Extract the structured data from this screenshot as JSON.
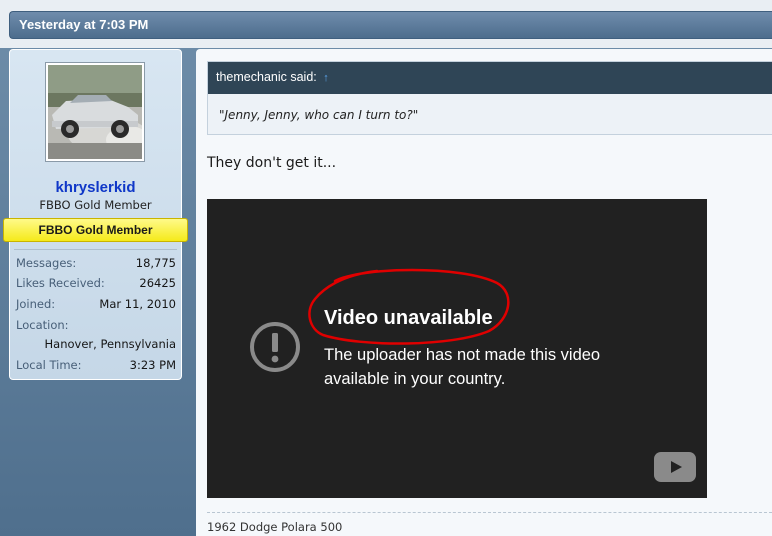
{
  "post": {
    "date": "Yesterday at 7:03 PM"
  },
  "user": {
    "username": "khryslerkid",
    "title": "FBBO Gold Member",
    "banner": "FBBO Gold Member",
    "stats": [
      {
        "label": "Messages:",
        "value": "18,775"
      },
      {
        "label": "Likes Received:",
        "value": "26425"
      },
      {
        "label": "Joined:",
        "value": "Mar 11, 2010"
      },
      {
        "label": "Location:",
        "value": ""
      },
      {
        "label": "",
        "value": "Hanover, Pennsylvania"
      },
      {
        "label": "Local Time:",
        "value": "3:23 PM"
      }
    ]
  },
  "quote": {
    "author": "themechanic said:",
    "arrow": "↑",
    "text": "\"Jenny, Jenny, who can I turn to?\""
  },
  "body": {
    "text": "They don't get it..."
  },
  "video": {
    "title": "Video unavailable",
    "message": "The uploader has not made this video available in your country."
  },
  "signature": {
    "text": "1962 Dodge Polara 500"
  },
  "colors": {
    "username": "#0f37c8",
    "banner_bg": "#f5ea1a",
    "quote_header_bg": "#2f4556",
    "video_bg": "#212121",
    "annotation": "#e00000"
  }
}
